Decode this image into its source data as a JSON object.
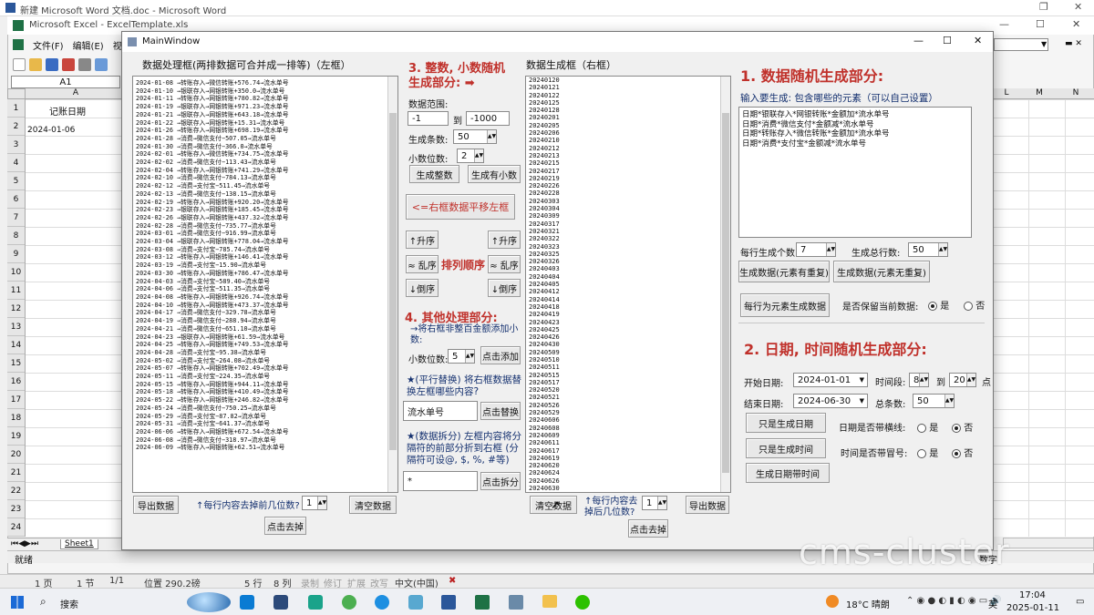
{
  "word": {
    "title": "新建 Microsoft Word 文档.doc - Microsoft Word"
  },
  "excel": {
    "title": "Microsoft Excel - ExcelTemplate.xls",
    "menu": [
      "文件(F)",
      "编辑(E)",
      "视图"
    ],
    "cell_ref": "A1",
    "col_a": "A",
    "right_cols": [
      "L",
      "M",
      "N"
    ],
    "header_cell": "记账日期",
    "first_value": "2024-01-06",
    "rows": [
      "1",
      "2",
      "3",
      "4",
      "5",
      "6",
      "7",
      "8",
      "9",
      "10",
      "11",
      "12",
      "13",
      "14",
      "15",
      "16",
      "17",
      "18",
      "19",
      "20",
      "21",
      "22",
      "23",
      "24"
    ],
    "sheet": "Sheet1",
    "status": "就绪",
    "right_status": "数字"
  },
  "word_status": [
    "1 页",
    "1 节",
    "1/1",
    "位置 290.2磅",
    "5 行",
    "8 列",
    "录制",
    "修订",
    "扩展",
    "改写",
    "中文(中国)"
  ],
  "app": {
    "title": "MainWindow"
  },
  "left": {
    "title": "数据处理框(两排数据可合并成一排等)（左框）",
    "lines": [
      "2024-01-08 →转账存入→微信转账+576.74→流水单号",
      "2024-01-10 →银联存入→网银转账+350.0→流水单号",
      "2024-01-11 →转账存入→网银转账+780.82→流水单号",
      "2024-01-19 →银联存入→网银转账+971.23→流水单号",
      "2024-01-21 →银联存入→网银转账+643.18→流水单号",
      "2024-01-22 →银联存入→网银转账+15.31→流水单号",
      "2024-01-26 →转账存入→网银转账+698.19→流水单号",
      "2024-01-28 →消费→微信支付−507.05→流水单号",
      "2024-01-30 →消费→微信支付−366.0→流水单号",
      "2024-02-01 →转账存入→微信转账+734.75→流水单号",
      "2024-02-02 →消费→微信支付−113.43→流水单号",
      "2024-02-04 →转账存入→网银转账+741.29→流水单号",
      "2024-02-10 →消费→微信支付−784.13→流水单号",
      "2024-02-12 →消费→支付宝−511.45→流水单号",
      "2024-02-13 →消费→微信支付−138.15→流水单号",
      "2024-02-19 →转账存入→网银转账+920.20→流水单号",
      "2024-02-23 →银联存入→网银转账+185.45→流水单号",
      "2024-02-26 →银联存入→网银转账+437.32→流水单号",
      "2024-02-28 →消费→微信支付−735.77→流水单号",
      "2024-03-01 →消费→微信支付−916.99→流水单号",
      "2024-03-04 →银联存入→网银转账+778.04→流水单号",
      "2024-03-08 →消费→支付宝−785.74→流水单号",
      "2024-03-12 →转账存入→网银转账+146.41→流水单号",
      "2024-03-19 →消费→支付宝−15.90→流水单号",
      "2024-03-30 →转账存入→网银转账+786.47→流水单号",
      "2024-04-03 →消费→支付宝−589.40→流水单号",
      "2024-04-06 →消费→支付宝−511.35→流水单号",
      "2024-04-08 →转账存入→网银转账+926.74→流水单号",
      "2024-04-10 →转账存入→网银转账+473.37→流水单号",
      "2024-04-17 →消费→微信支付−329.78→流水单号",
      "2024-04-19 →消费→微信支付−288.94→流水单号",
      "2024-04-21 →消费→微信支付−651.10→流水单号",
      "2024-04-23 →银联存入→网银转账+61.59→流水单号",
      "2024-04-25 →转账存入→网银转账+749.53→流水单号",
      "2024-04-28 →消费→支付宝−95.38→流水单号",
      "2024-05-02 →消费→支付宝−264.08→流水单号",
      "2024-05-07 →转账存入→网银转账+702.49→流水单号",
      "2024-05-11 →消费→支付宝−224.35→流水单号",
      "2024-05-15 →转账存入→网银转账+944.11→流水单号",
      "2024-05-18 →转账存入→网银转账+410.49→流水单号",
      "2024-05-22 →转账存入→网银转账+246.82→流水单号",
      "2024-05-24 →消费→微信支付−750.25→流水单号",
      "2024-05-29 →消费→支付宝−87.82→流水单号",
      "2024-05-31 →消费→支付宝−641.37→流水单号",
      "2024-06-06 →转账存入→网银转账+672.54→流水单号",
      "2024-06-08 →消费→微信支付−318.97→流水单号",
      "2024-06-09 →转账存入→网银转账+62.51→流水单号"
    ],
    "export": "导出数据",
    "trim_label": "↑每行内容去掉前几位数?",
    "trim_value": "1",
    "clear": "清空数据",
    "trim_btn": "点击去掉"
  },
  "mid": {
    "sec3": "3. 整数, 小数随机生成部分: ➡",
    "range_label": "数据范围:",
    "range_min": "-1",
    "range_to": "到",
    "range_max": "-1000",
    "count_label": "生成条数:",
    "count": "50",
    "dec_label": "小数位数:",
    "dec": "2",
    "gen_int": "生成整数",
    "gen_dec": "生成有小数",
    "shift": "<=右框数据平移左框",
    "sort_label": "排列顺序",
    "asc": "↑升序",
    "shuffle": "≈ 乱序",
    "desc": "↓倒序",
    "sec4": "4. 其他处理部分:",
    "add_desc": "→将右框非整百金额添加小数:",
    "add_dec_label": "小数位数:",
    "add_dec": "5",
    "add_btn": "点击添加",
    "replace_desc": "★(平行替换) 将右框数据替换左框哪些内容?",
    "replace_value": "流水单号",
    "replace_btn": "点击替换",
    "split_desc": "★(数据拆分) 左框内容将分隔符的前部分折到右框 (分隔符可设@, $, %, #等)",
    "split_value": "*",
    "split_btn": "点击拆分"
  },
  "right": {
    "title": "数据生成框（右框）",
    "lines": [
      "20240120",
      "20240121",
      "20240122",
      "20240125",
      "20240128",
      "20240201",
      "20240205",
      "20240206",
      "20240210",
      "20240212",
      "20240213",
      "20240215",
      "20240217",
      "20240219",
      "20240226",
      "20240228",
      "20240303",
      "20240304",
      "20240309",
      "20240317",
      "20240321",
      "20240322",
      "20240323",
      "20240325",
      "20240326",
      "20240403",
      "20240404",
      "20240405",
      "20240412",
      "20240414",
      "20240418",
      "20240419",
      "20240423",
      "20240425",
      "20240426",
      "20240430",
      "20240509",
      "20240510",
      "20240511",
      "20240515",
      "20240517",
      "20240520",
      "20240521",
      "20240526",
      "20240529",
      "20240606",
      "20240608",
      "20240609",
      "20240611",
      "20240617",
      "20240619",
      "20240620",
      "20240624",
      "20240626",
      "20240630"
    ],
    "clear": "清空数据",
    "trim_label": "↑每行内容去掉后几位数?",
    "trim_value": "1",
    "export": "导出数据",
    "trim_btn": "点击去掉"
  },
  "sec1": {
    "title": "1. 数据随机生成部分:",
    "input_label": "输入要生成: 包含哪些的元素（可以自己设置）",
    "elements": [
      "日期*银联存入*网银转账*金额加*流水单号",
      "日期*消费*微信支付*金额减*流水单号",
      "日期*转账存入*微信转账*金额加*流水单号",
      "日期*消费*支付宝*金额减*流水单号"
    ],
    "per_row_label": "每行生成个数:",
    "per_row": "7",
    "total_label": "生成总行数:",
    "total": "50",
    "gen_repeat": "生成数据(元素有重复)",
    "gen_norepeat": "生成数据(元素无重复)",
    "gen_each": "每行为元素生成数据",
    "keep_label": "是否保留当前数据:",
    "yes": "是",
    "no": "否"
  },
  "sec2": {
    "title": "2. 日期, 时间随机生成部分:",
    "start_label": "开始日期:",
    "start": "2024-01-01",
    "period_label": "时间段:",
    "hour_from": "8",
    "hour_to_label": "到",
    "hour_to": "20",
    "hour_unit": "点",
    "end_label": "结束日期:",
    "end": "2024-06-30",
    "total_label": "总条数:",
    "total": "50",
    "only_date": "只是生成日期",
    "only_time": "只是生成时间",
    "date_time": "生成日期带时间",
    "dash_label": "日期是否带横线:",
    "colon_label": "时间是否带冒号:",
    "yes": "是",
    "no": "否"
  },
  "taskbar": {
    "search": "搜索",
    "weather": "18°C 晴朗",
    "ime": "英",
    "time": "17:04",
    "date": "2025-01-11"
  },
  "watermark": "cms-cluster"
}
